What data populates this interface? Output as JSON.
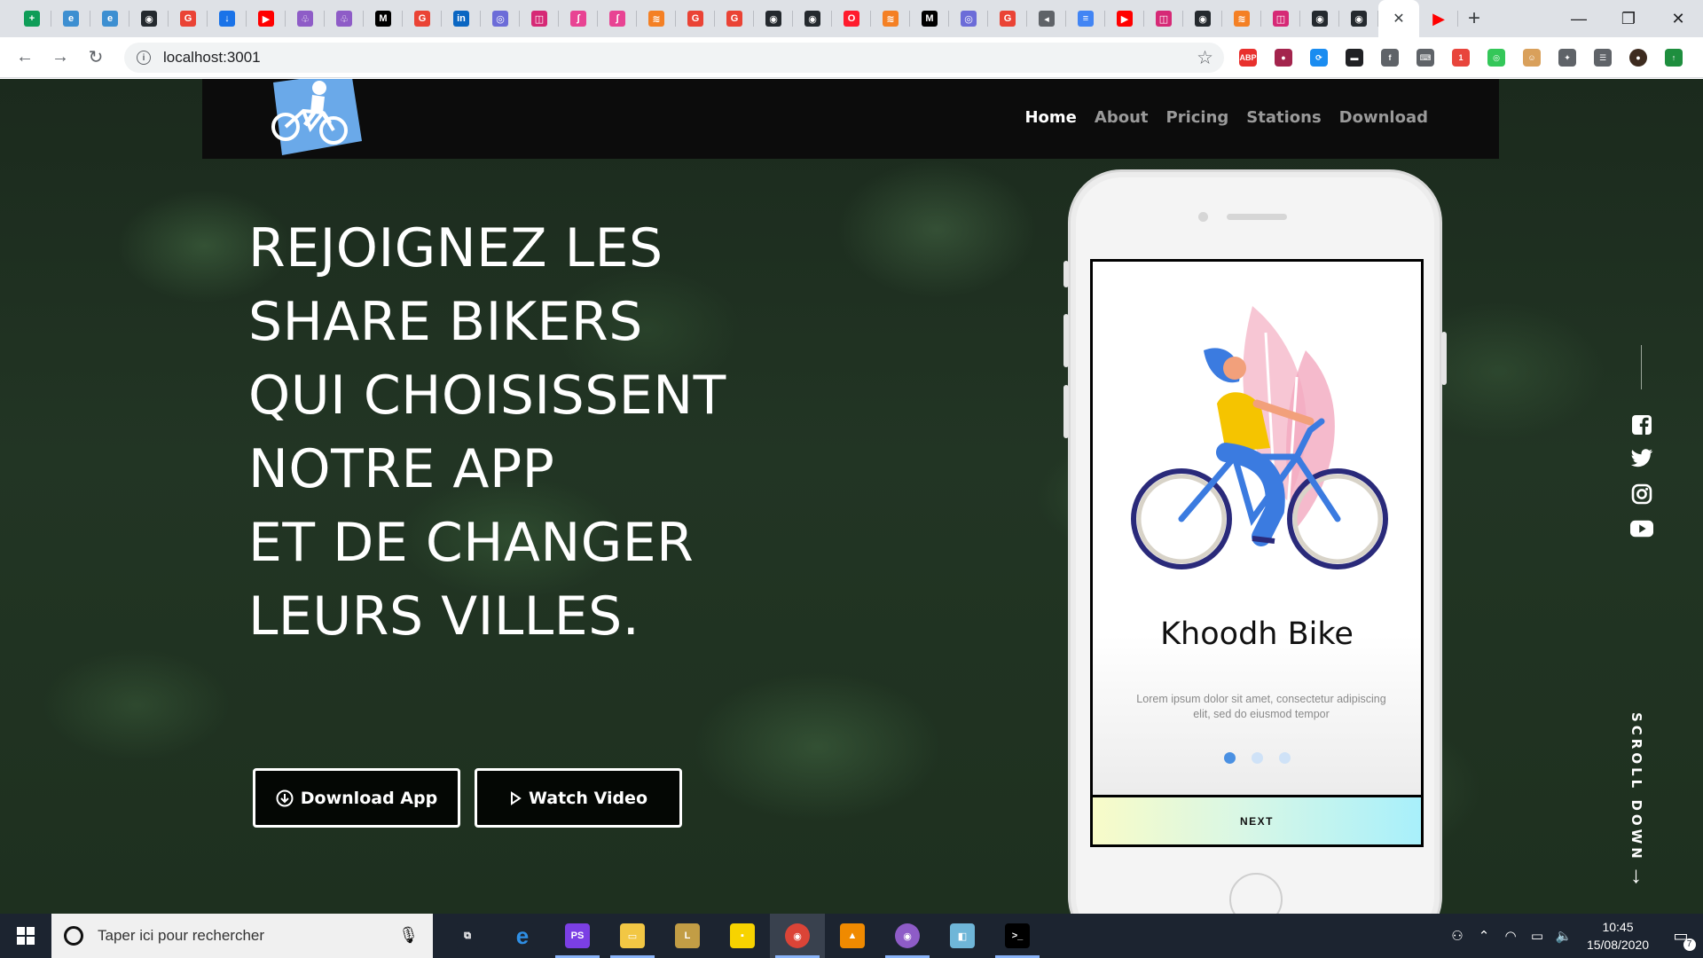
{
  "browser": {
    "tabs": [
      {
        "icon": "sheets-icon",
        "color": "#0f9d58",
        "glyph": "+"
      },
      {
        "icon": "edge-icon",
        "color": "#3d8fd1",
        "glyph": "e"
      },
      {
        "icon": "edge-icon",
        "color": "#3d8fd1",
        "glyph": "e"
      },
      {
        "icon": "github-icon",
        "color": "#24292e",
        "glyph": "◉"
      },
      {
        "icon": "google-icon",
        "color": "#ea4335",
        "glyph": "G"
      },
      {
        "icon": "download-icon",
        "color": "#1a73e8",
        "glyph": "↓"
      },
      {
        "icon": "youtube-icon",
        "color": "#ff0000",
        "glyph": "▶"
      },
      {
        "icon": "octopus-icon",
        "color": "#8e5cc7",
        "glyph": "♧"
      },
      {
        "icon": "octopus-icon",
        "color": "#8e5cc7",
        "glyph": "♧"
      },
      {
        "icon": "medium-icon",
        "color": "#000000",
        "glyph": "M"
      },
      {
        "icon": "google-icon",
        "color": "#ea4335",
        "glyph": "G"
      },
      {
        "icon": "linkedin-icon",
        "color": "#0a66c2",
        "glyph": "in"
      },
      {
        "icon": "circle-app-icon",
        "color": "#6c6cd8",
        "glyph": "◎"
      },
      {
        "icon": "instagram-icon",
        "color": "#d62976",
        "glyph": "◫"
      },
      {
        "icon": "feather-icon",
        "color": "#e84393",
        "glyph": "∫"
      },
      {
        "icon": "feather-icon",
        "color": "#e84393",
        "glyph": "∫"
      },
      {
        "icon": "stack-icon",
        "color": "#f48024",
        "glyph": "≋"
      },
      {
        "icon": "google-icon",
        "color": "#ea4335",
        "glyph": "G"
      },
      {
        "icon": "google-icon",
        "color": "#ea4335",
        "glyph": "G"
      },
      {
        "icon": "github-icon",
        "color": "#24292e",
        "glyph": "◉"
      },
      {
        "icon": "github-icon",
        "color": "#24292e",
        "glyph": "◉"
      },
      {
        "icon": "opera-icon",
        "color": "#ff1b2d",
        "glyph": "O"
      },
      {
        "icon": "stack-icon",
        "color": "#f48024",
        "glyph": "≋"
      },
      {
        "icon": "medium-icon",
        "color": "#000000",
        "glyph": "M"
      },
      {
        "icon": "circle-app-icon",
        "color": "#6c6cd8",
        "glyph": "◎"
      },
      {
        "icon": "google-icon",
        "color": "#ea4335",
        "glyph": "G"
      },
      {
        "icon": "audio-icon",
        "color": "#5f6368",
        "glyph": "◂"
      },
      {
        "icon": "docs-icon",
        "color": "#4285f4",
        "glyph": "≡"
      },
      {
        "icon": "youtube-icon",
        "color": "#ff0000",
        "glyph": "▶"
      },
      {
        "icon": "instagram-icon",
        "color": "#d62976",
        "glyph": "◫"
      },
      {
        "icon": "github-icon",
        "color": "#24292e",
        "glyph": "◉"
      },
      {
        "icon": "stack-icon",
        "color": "#f48024",
        "glyph": "≋"
      },
      {
        "icon": "instagram-icon",
        "color": "#d62976",
        "glyph": "◫"
      },
      {
        "icon": "github-icon",
        "color": "#24292e",
        "glyph": "◉"
      },
      {
        "icon": "github-icon",
        "color": "#24292e",
        "glyph": "◉"
      }
    ],
    "active_tab_close": "✕",
    "after_active_tab": {
      "icon": "youtube-play-icon",
      "color": "#ff0000",
      "glyph": "▶"
    },
    "new_tab": "+",
    "window": {
      "minimize": "—",
      "restore": "❐",
      "close": "✕"
    },
    "nav": {
      "back": "←",
      "forward": "→",
      "reload": "↻"
    },
    "url": "localhost:3001",
    "info_glyph": "i",
    "star": "☆",
    "extensions": [
      {
        "icon": "adblock-icon",
        "color": "#e8302d",
        "glyph": "ABP"
      },
      {
        "icon": "record-icon",
        "color": "#a3244d",
        "glyph": "●"
      },
      {
        "icon": "sync-icon",
        "color": "#1a8cf0",
        "glyph": "⟳"
      },
      {
        "icon": "terminal-icon",
        "color": "#202124",
        "glyph": "▬"
      },
      {
        "icon": "facebook-ext-icon",
        "color": "#5f6368",
        "glyph": "f"
      },
      {
        "icon": "keyboard-icon",
        "color": "#5f6368",
        "glyph": "⌨"
      },
      {
        "icon": "shapes-icon",
        "color": "#e8453c",
        "glyph": "1"
      },
      {
        "icon": "target-icon",
        "color": "#34c759",
        "glyph": "◎"
      },
      {
        "icon": "face-icon",
        "color": "#d9a05b",
        "glyph": "☺"
      },
      {
        "icon": "puzzle-icon",
        "color": "#5f6368",
        "glyph": "✦"
      },
      {
        "icon": "queue-icon",
        "color": "#5f6368",
        "glyph": "☰"
      },
      {
        "icon": "profile-avatar-icon",
        "color": "#3d2b1f",
        "glyph": "●"
      },
      {
        "icon": "update-icon",
        "color": "#1e8e3e",
        "glyph": "↑"
      }
    ]
  },
  "site": {
    "nav": [
      "Home",
      "About",
      "Pricing",
      "Stations",
      "Download"
    ],
    "hero_lines": [
      "REJOIGNEZ LES",
      "SHARE BIKERS",
      "QUI CHOISISSENT",
      "NOTRE APP",
      "ET DE CHANGER",
      "LEURS VILLES."
    ],
    "btn_download": "Download App",
    "btn_watch": "Watch Video",
    "phone": {
      "title": "Khoodh Bike",
      "desc": "Lorem ipsum dolor sit amet, consectetur adipiscing elit, sed do eiusmod tempor",
      "next": "NEXT",
      "active_dot": 1,
      "dots": 3
    },
    "socials": [
      "facebook-icon",
      "twitter-icon",
      "instagram-icon",
      "youtube-icon"
    ],
    "scroll_text": "SCROLL DOWN",
    "scroll_arrow": "↓"
  },
  "taskbar": {
    "search_placeholder": "Taper ici pour rechercher",
    "apps": [
      {
        "icon": "task-view-icon",
        "color": "#1c2430",
        "glyph": "⧉"
      },
      {
        "icon": "edge-legacy-icon",
        "color": "#1c2430",
        "glyph": "e"
      },
      {
        "icon": "phpstorm-icon",
        "color": "#7b3fe4",
        "glyph": "PS"
      },
      {
        "icon": "file-explorer-icon",
        "color": "#f2c744",
        "glyph": "▭"
      },
      {
        "icon": "league-icon",
        "color": "#c29d45",
        "glyph": "L"
      },
      {
        "icon": "sticky-notes-icon",
        "color": "#f7d300",
        "glyph": "▪"
      },
      {
        "icon": "chrome-icon",
        "color": "#db4437",
        "glyph": "◉"
      },
      {
        "icon": "vlc-icon",
        "color": "#f08a00",
        "glyph": "▲"
      },
      {
        "icon": "github-desktop-icon",
        "color": "#8e5cc7",
        "glyph": "◉"
      },
      {
        "icon": "notepad-icon",
        "color": "#6fb6d8",
        "glyph": "◧"
      },
      {
        "icon": "cmd-icon",
        "color": "#000000",
        "glyph": ">_"
      }
    ],
    "time": "10:45",
    "date": "15/08/2020",
    "notif_count": "7"
  }
}
